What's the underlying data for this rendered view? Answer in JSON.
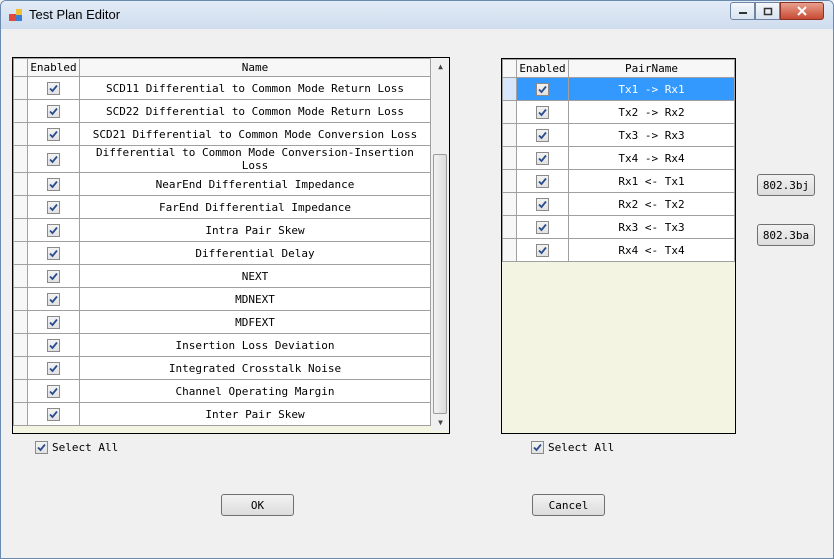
{
  "window": {
    "title": "Test Plan Editor"
  },
  "tests": {
    "columns": [
      "Enabled",
      "Name"
    ],
    "rows": [
      {
        "enabled": true,
        "name": "SCD11 Differential to Common Mode Return Loss"
      },
      {
        "enabled": true,
        "name": "SCD22 Differential to Common Mode Return Loss"
      },
      {
        "enabled": true,
        "name": "SCD21 Differential to Common Mode Conversion Loss"
      },
      {
        "enabled": true,
        "name": "Differential to Common Mode Conversion-Insertion Loss"
      },
      {
        "enabled": true,
        "name": "NearEnd Differential Impedance"
      },
      {
        "enabled": true,
        "name": "FarEnd Differential Impedance"
      },
      {
        "enabled": true,
        "name": "Intra Pair Skew"
      },
      {
        "enabled": true,
        "name": "Differential Delay"
      },
      {
        "enabled": true,
        "name": "NEXT"
      },
      {
        "enabled": true,
        "name": "MDNEXT"
      },
      {
        "enabled": true,
        "name": "MDFEXT"
      },
      {
        "enabled": true,
        "name": "Insertion Loss Deviation"
      },
      {
        "enabled": true,
        "name": "Integrated Crosstalk Noise"
      },
      {
        "enabled": true,
        "name": "Channel Operating Margin"
      },
      {
        "enabled": true,
        "name": "Inter Pair Skew"
      }
    ],
    "select_all_label": "Select All",
    "select_all_checked": true
  },
  "pairs": {
    "columns": [
      "Enabled",
      "PairName"
    ],
    "rows": [
      {
        "enabled": true,
        "name": "Tx1 -> Rx1"
      },
      {
        "enabled": true,
        "name": "Tx2 -> Rx2"
      },
      {
        "enabled": true,
        "name": "Tx3 -> Rx3"
      },
      {
        "enabled": true,
        "name": "Tx4 -> Rx4"
      },
      {
        "enabled": true,
        "name": "Rx1 <- Tx1"
      },
      {
        "enabled": true,
        "name": "Rx2 <- Tx2"
      },
      {
        "enabled": true,
        "name": "Rx3 <- Tx3"
      },
      {
        "enabled": true,
        "name": "Rx4 <- Tx4"
      }
    ],
    "selected_row": 0,
    "select_all_label": "Select All",
    "select_all_checked": true
  },
  "standards": {
    "btn1": "802.3bj",
    "btn2": "802.3ba"
  },
  "actions": {
    "ok": "OK",
    "cancel": "Cancel"
  }
}
